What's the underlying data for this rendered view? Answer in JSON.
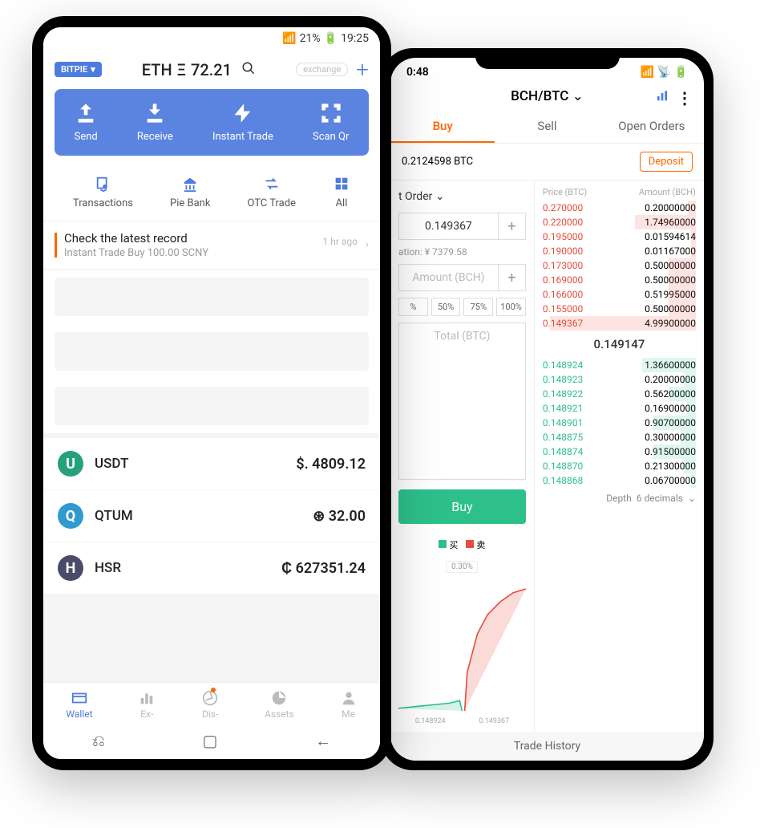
{
  "android": {
    "status": {
      "signal": "21%",
      "time": "19:25"
    },
    "chip": "BITPIE",
    "pair": "ETH",
    "pair_symbol": "Ξ",
    "pair_value": "72.21",
    "exchange_pill": "exchange",
    "actions": [
      {
        "id": "send",
        "label": "Send"
      },
      {
        "id": "receive",
        "label": "Receive"
      },
      {
        "id": "instant-trade",
        "label": "Instant Trade"
      },
      {
        "id": "scan-qr",
        "label": "Scan Qr"
      }
    ],
    "secondary": [
      {
        "id": "transactions",
        "label": "Transactions"
      },
      {
        "id": "pie-bank",
        "label": "Pie Bank"
      },
      {
        "id": "otc-trade",
        "label": "OTC Trade"
      },
      {
        "id": "all",
        "label": "All"
      }
    ],
    "banner": {
      "title": "Check the latest record",
      "sub": "Instant Trade Buy 100.00 SCNY",
      "time": "1 hr ago"
    },
    "coins": [
      {
        "id": "usdt",
        "name": "USDT",
        "symbol": "$.",
        "amount": "4809.12",
        "color": "#26a17b"
      },
      {
        "id": "qtum",
        "name": "QTUM",
        "symbol": "⊛",
        "amount": "32.00",
        "color": "#2e9ad0"
      },
      {
        "id": "hsr",
        "name": "HSR",
        "symbol": "₵",
        "amount": "627351.24",
        "color": "#4a4a6a"
      }
    ],
    "nav": [
      {
        "id": "wallet",
        "label": "Wallet",
        "active": true
      },
      {
        "id": "ex",
        "label": "Ex-"
      },
      {
        "id": "dis",
        "label": "Dis-",
        "dot": true
      },
      {
        "id": "assets",
        "label": "Assets"
      },
      {
        "id": "me",
        "label": "Me"
      }
    ]
  },
  "iphone": {
    "status_time": "0:48",
    "pair": "BCH/BTC",
    "tabs": {
      "buy": "Buy",
      "sell": "Sell",
      "open": "Open Orders"
    },
    "balance": "0.2124598 BTC",
    "deposit": "Deposit",
    "order_type": "t Order",
    "price_input": "0.149367",
    "valuation": "ation: ¥ 7379.58",
    "amount_ph": "Amount (BCH)",
    "pcts": [
      "%",
      "50%",
      "75%",
      "100%"
    ],
    "total_ph": "Total (BTC)",
    "buy_btn": "Buy",
    "legend_buy": "买",
    "legend_sell": "卖",
    "pct_label": "0.30%",
    "chart_x": [
      "0.148924",
      "0.149367"
    ],
    "book_head_price": "Price (BTC)",
    "book_head_amt": "Amount (BCH)",
    "asks": [
      {
        "p": "0.270000",
        "a": "0.20000000",
        "d": 5
      },
      {
        "p": "0.220000",
        "a": "1.74960000",
        "d": 40
      },
      {
        "p": "0.195000",
        "a": "0.01594614",
        "d": 3
      },
      {
        "p": "0.190000",
        "a": "0.01167000",
        "d": 3
      },
      {
        "p": "0.173000",
        "a": "0.50000000",
        "d": 18
      },
      {
        "p": "0.169000",
        "a": "0.50000000",
        "d": 18
      },
      {
        "p": "0.166000",
        "a": "0.51995000",
        "d": 18
      },
      {
        "p": "0.155000",
        "a": "0.50000000",
        "d": 18
      },
      {
        "p": "0.149367",
        "a": "4.99900000",
        "d": 95
      }
    ],
    "mid_price": "0.149147",
    "bids": [
      {
        "p": "0.148924",
        "a": "1.36600000",
        "d": 35
      },
      {
        "p": "0.148923",
        "a": "0.20000000",
        "d": 8
      },
      {
        "p": "0.148922",
        "a": "0.56200000",
        "d": 18
      },
      {
        "p": "0.148921",
        "a": "0.16900000",
        "d": 6
      },
      {
        "p": "0.148901",
        "a": "0.90700000",
        "d": 28
      },
      {
        "p": "0.148875",
        "a": "0.30000000",
        "d": 10
      },
      {
        "p": "0.148874",
        "a": "0.91500000",
        "d": 28
      },
      {
        "p": "0.148870",
        "a": "0.21300000",
        "d": 8
      },
      {
        "p": "0.148868",
        "a": "0.06700000",
        "d": 3
      }
    ],
    "depth_label": "Depth",
    "depth_value": "6 decimals",
    "trade_history": "Trade History"
  },
  "chart_data": {
    "type": "line",
    "title": "Depth chart",
    "x": [
      0.148924,
      0.149367
    ],
    "series": [
      {
        "name": "买",
        "color": "#2ec08b"
      },
      {
        "name": "卖",
        "color": "#e74c3c"
      }
    ],
    "pct_spread": 0.3
  }
}
